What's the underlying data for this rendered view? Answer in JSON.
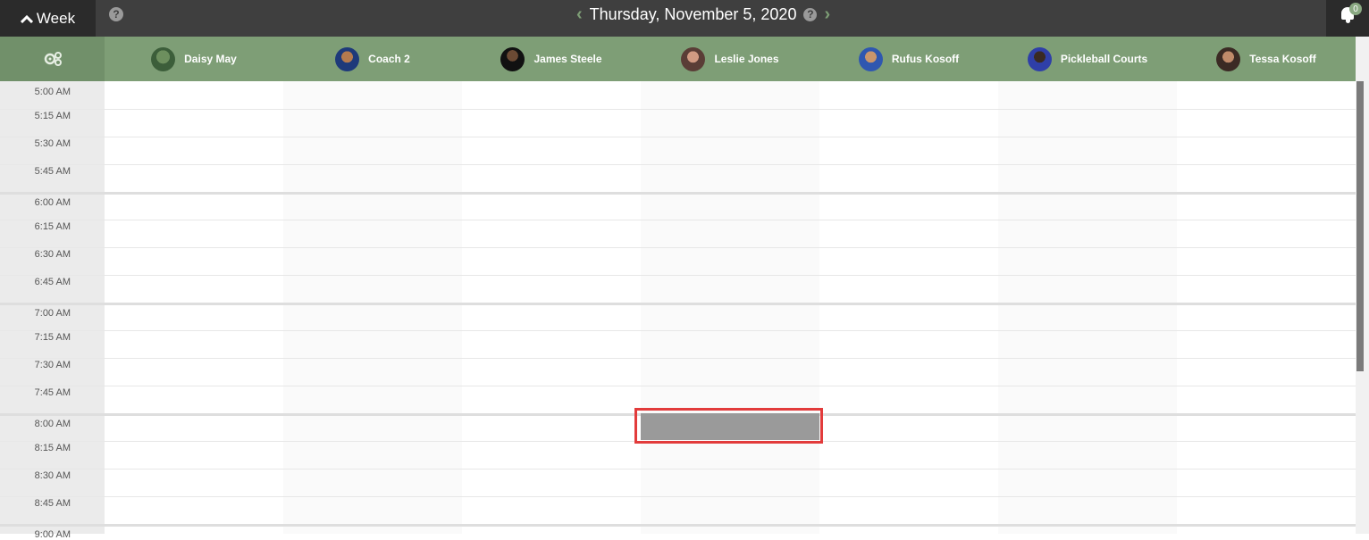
{
  "topbar": {
    "view_label": "Week",
    "date_label": "Thursday, November 5, 2020",
    "notification_count": "0"
  },
  "resources": [
    {
      "name": "Daisy May"
    },
    {
      "name": "Coach 2"
    },
    {
      "name": "James Steele"
    },
    {
      "name": "Leslie Jones"
    },
    {
      "name": "Rufus Kosoff"
    },
    {
      "name": "Pickleball Courts"
    },
    {
      "name": "Tessa Kosoff"
    }
  ],
  "times": [
    "5:00 AM",
    "5:15 AM",
    "5:30 AM",
    "5:45 AM",
    "6:00 AM",
    "6:15 AM",
    "6:30 AM",
    "6:45 AM",
    "7:00 AM",
    "7:15 AM",
    "7:30 AM",
    "7:45 AM",
    "8:00 AM",
    "8:15 AM",
    "8:30 AM",
    "8:45 AM",
    "9:00 AM"
  ],
  "colors": {
    "header_green": "#7e9e76",
    "selection_outline": "#e23b3b",
    "slot_fill": "#9a9a9a"
  }
}
